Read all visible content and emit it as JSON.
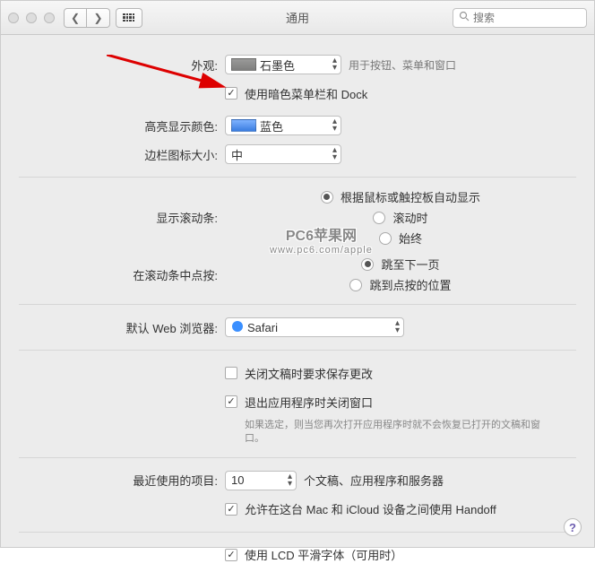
{
  "window": {
    "title": "通用"
  },
  "search": {
    "placeholder": "搜索"
  },
  "appearance": {
    "label": "外观:",
    "value": "石墨色",
    "hint": "用于按钮、菜单和窗口",
    "dark_menu": {
      "label": "使用暗色菜单栏和 Dock",
      "checked": true
    }
  },
  "highlight": {
    "label": "高亮显示颜色:",
    "value": "蓝色"
  },
  "sidebar_size": {
    "label": "边栏图标大小:",
    "value": "中"
  },
  "scrollbar": {
    "label": "显示滚动条:",
    "options": [
      {
        "label": "根据鼠标或触控板自动显示",
        "checked": true
      },
      {
        "label": "滚动时",
        "checked": false
      },
      {
        "label": "始终",
        "checked": false
      }
    ]
  },
  "scroll_click": {
    "label": "在滚动条中点按:",
    "options": [
      {
        "label": "跳至下一页",
        "checked": true
      },
      {
        "label": "跳到点按的位置",
        "checked": false
      }
    ]
  },
  "default_browser": {
    "label": "默认 Web 浏览器:",
    "value": "Safari"
  },
  "close_docs": {
    "ask": {
      "label": "关闭文稿时要求保存更改",
      "checked": false
    },
    "quit": {
      "label": "退出应用程序时关闭窗口",
      "checked": true
    },
    "hint": "如果选定，则当您再次打开应用程序时就不会恢复已打开的文稿和窗口。"
  },
  "recent": {
    "label": "最近使用的项目:",
    "value": "10",
    "suffix": "个文稿、应用程序和服务器",
    "handoff": {
      "label": "允许在这台 Mac 和 iCloud 设备之间使用 Handoff",
      "checked": true
    }
  },
  "lcd": {
    "label": "使用 LCD 平滑字体（可用时）",
    "checked": true
  },
  "watermark": {
    "main": "PC6苹果网",
    "sub": "www.pc6.com/apple"
  },
  "help": "?"
}
